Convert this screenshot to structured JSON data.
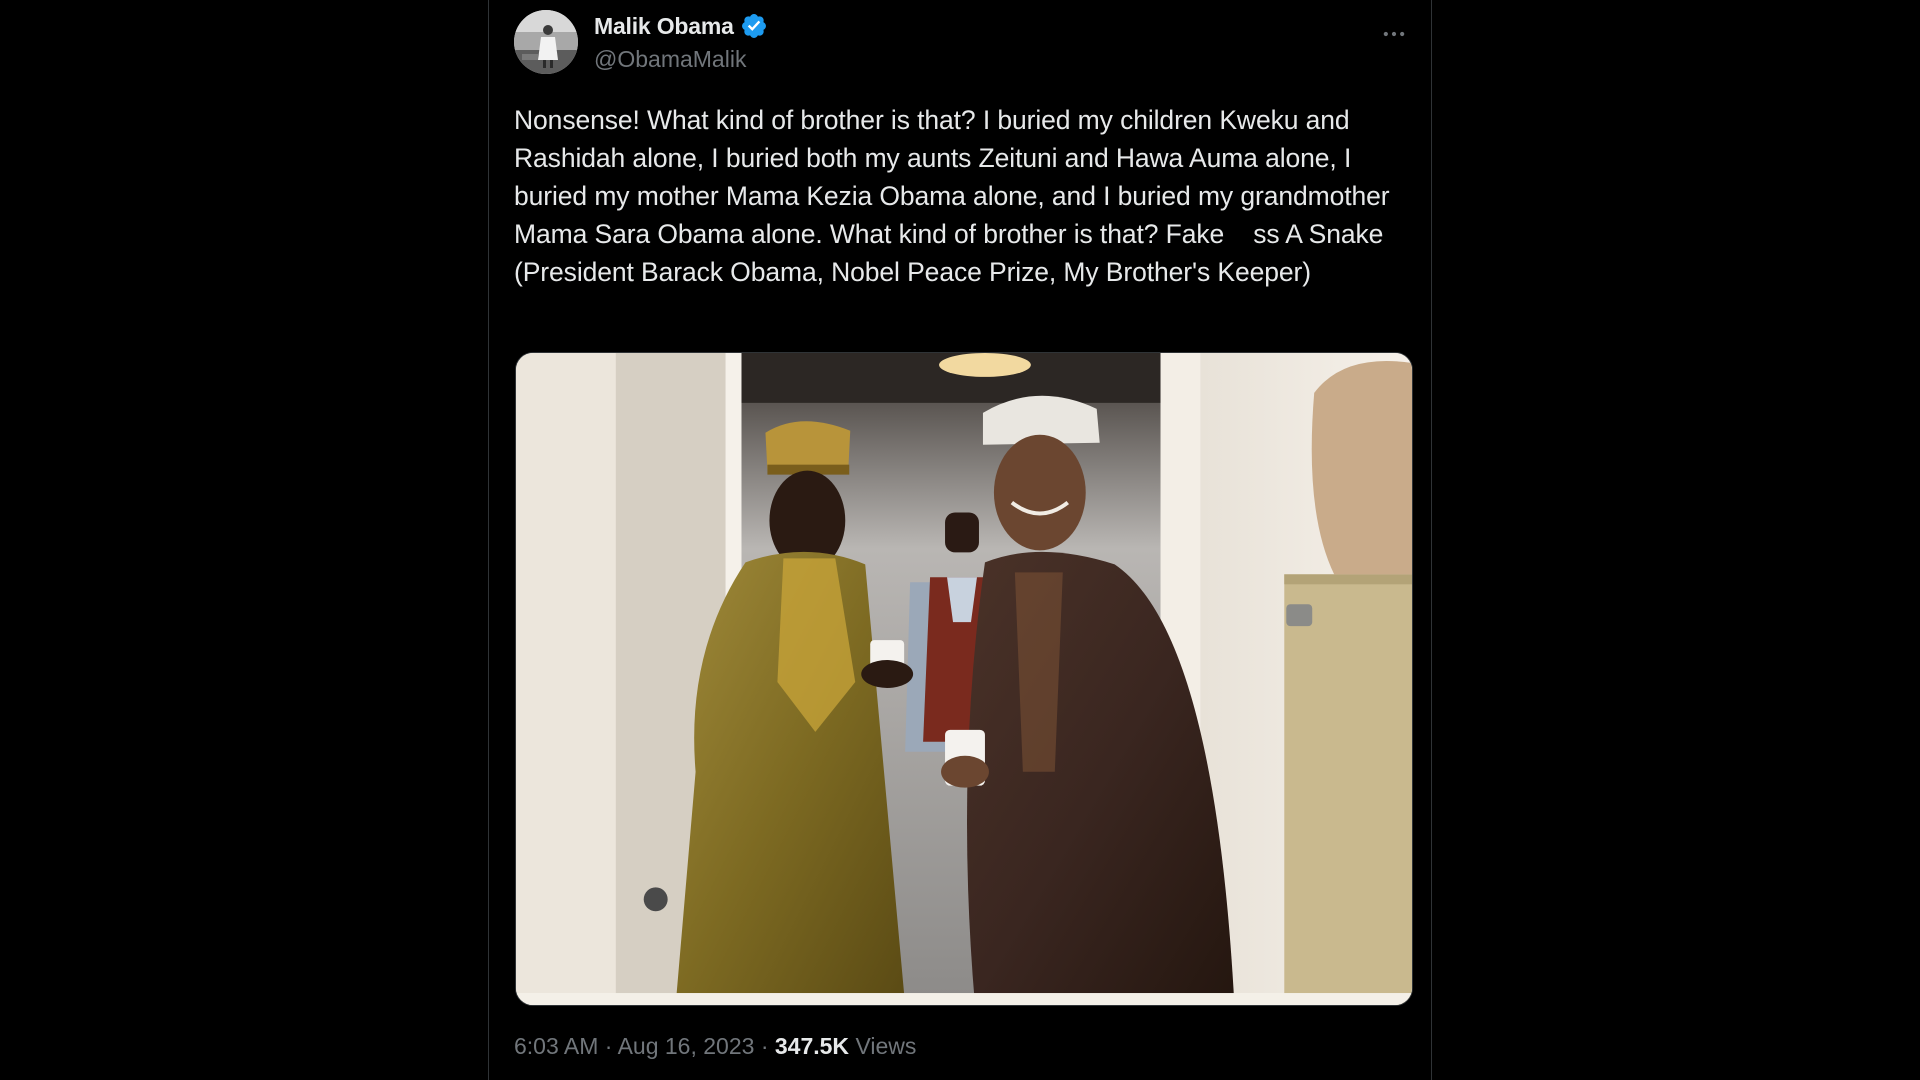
{
  "tweet": {
    "author": {
      "display_name": "Malik Obama",
      "handle": "@ObamaMalik",
      "verified": true,
      "verified_color": "#1d9bf0"
    },
    "text": "Nonsense! What kind of brother is that? I buried my children Kweku and Rashidah alone, I buried both my aunts Zeituni and Hawa Auma alone, I buried my mother Mama Kezia Obama alone, and I buried my grandmother Mama Sara Obama alone. What kind of brother is that? Fake    ss A Snake (President Barack Obama, Nobel Peace Prize, My Brother's Keeper)",
    "time": "6:03 AM",
    "separator": "·",
    "date": "Aug 16, 2023",
    "views_count": "347.5K",
    "views_label": "Views"
  },
  "icons": {
    "verified": "verified-badge-icon",
    "more": "more-horizontal-icon"
  },
  "colors": {
    "background": "#000000",
    "text_primary": "#e7e9ea",
    "text_secondary": "#71767b",
    "border": "#2f3336",
    "accent": "#1d9bf0"
  }
}
